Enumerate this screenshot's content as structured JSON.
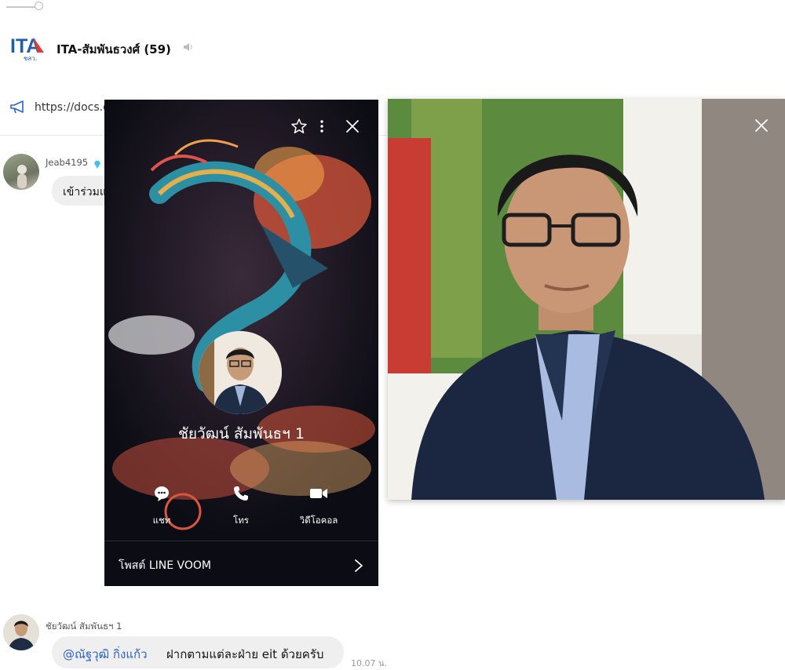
{
  "header": {
    "group_name": "ITA-สัมพันธวงศ์ (59)",
    "logo_text": "ITA",
    "logo_subtext": "ชสว.",
    "mute_icon": "speaker-muted-icon"
  },
  "announcement": {
    "icon": "megaphone-icon",
    "text": "https://docs.google.com/forms/d/e/1FAIpQLSe..."
  },
  "messages": [
    {
      "sender": "Jeab4195",
      "badge_icon": "diamond-icon",
      "text": "เข้าร่วมแ"
    },
    {
      "sender": "ชัยวัฒน์ สัมพันธฯ 1",
      "mention": "@ณัฐวุฒิ กิ่งแก้ว",
      "text": "ฝากตามแต่ละฝ่าย eit ด้วยครับ",
      "time": "10.07 น."
    }
  ],
  "profile_card": {
    "name": "ชัยวัฒน์ สัมพันธฯ 1",
    "actions": [
      {
        "label": "แชท",
        "icon": "chat-bubble-icon"
      },
      {
        "label": "โทร",
        "icon": "phone-icon"
      },
      {
        "label": "วิดีโอคอล",
        "icon": "video-camera-icon"
      }
    ],
    "voom_label": "โพสต์ LINE VOOM",
    "toolbar_icons": [
      "star-icon",
      "more-icon",
      "close-icon"
    ]
  },
  "photo_viewer": {
    "close_icon": "close-icon"
  },
  "colors": {
    "mention": "#2e63c4",
    "bubble": "#efefef",
    "card_bg": "#0b0c14",
    "logo_blue": "#1f5fa8"
  }
}
